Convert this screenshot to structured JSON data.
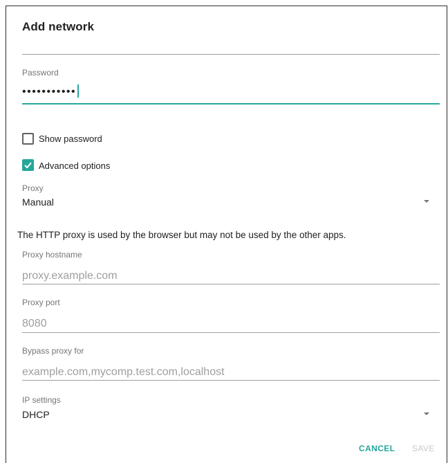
{
  "dialog": {
    "title": "Add network"
  },
  "password": {
    "label": "Password",
    "masked_value": "•••••••••••"
  },
  "show_password": {
    "label": "Show password",
    "checked": false
  },
  "advanced_options": {
    "label": "Advanced options",
    "checked": true
  },
  "proxy": {
    "label": "Proxy",
    "value": "Manual"
  },
  "proxy_note": "The HTTP proxy is used by the browser but may not be used by the other apps.",
  "proxy_hostname": {
    "label": "Proxy hostname",
    "placeholder": "proxy.example.com"
  },
  "proxy_port": {
    "label": "Proxy port",
    "placeholder": "8080"
  },
  "bypass_proxy": {
    "label": "Bypass proxy for",
    "placeholder": "example.com,mycomp.test.com,localhost"
  },
  "ip_settings": {
    "label": "IP settings",
    "value": "DHCP"
  },
  "buttons": {
    "cancel": "CANCEL",
    "save": "SAVE"
  },
  "colors": {
    "accent": "#26a69a",
    "disabled": "#c8c8c8",
    "divider": "#9e9e9e"
  }
}
